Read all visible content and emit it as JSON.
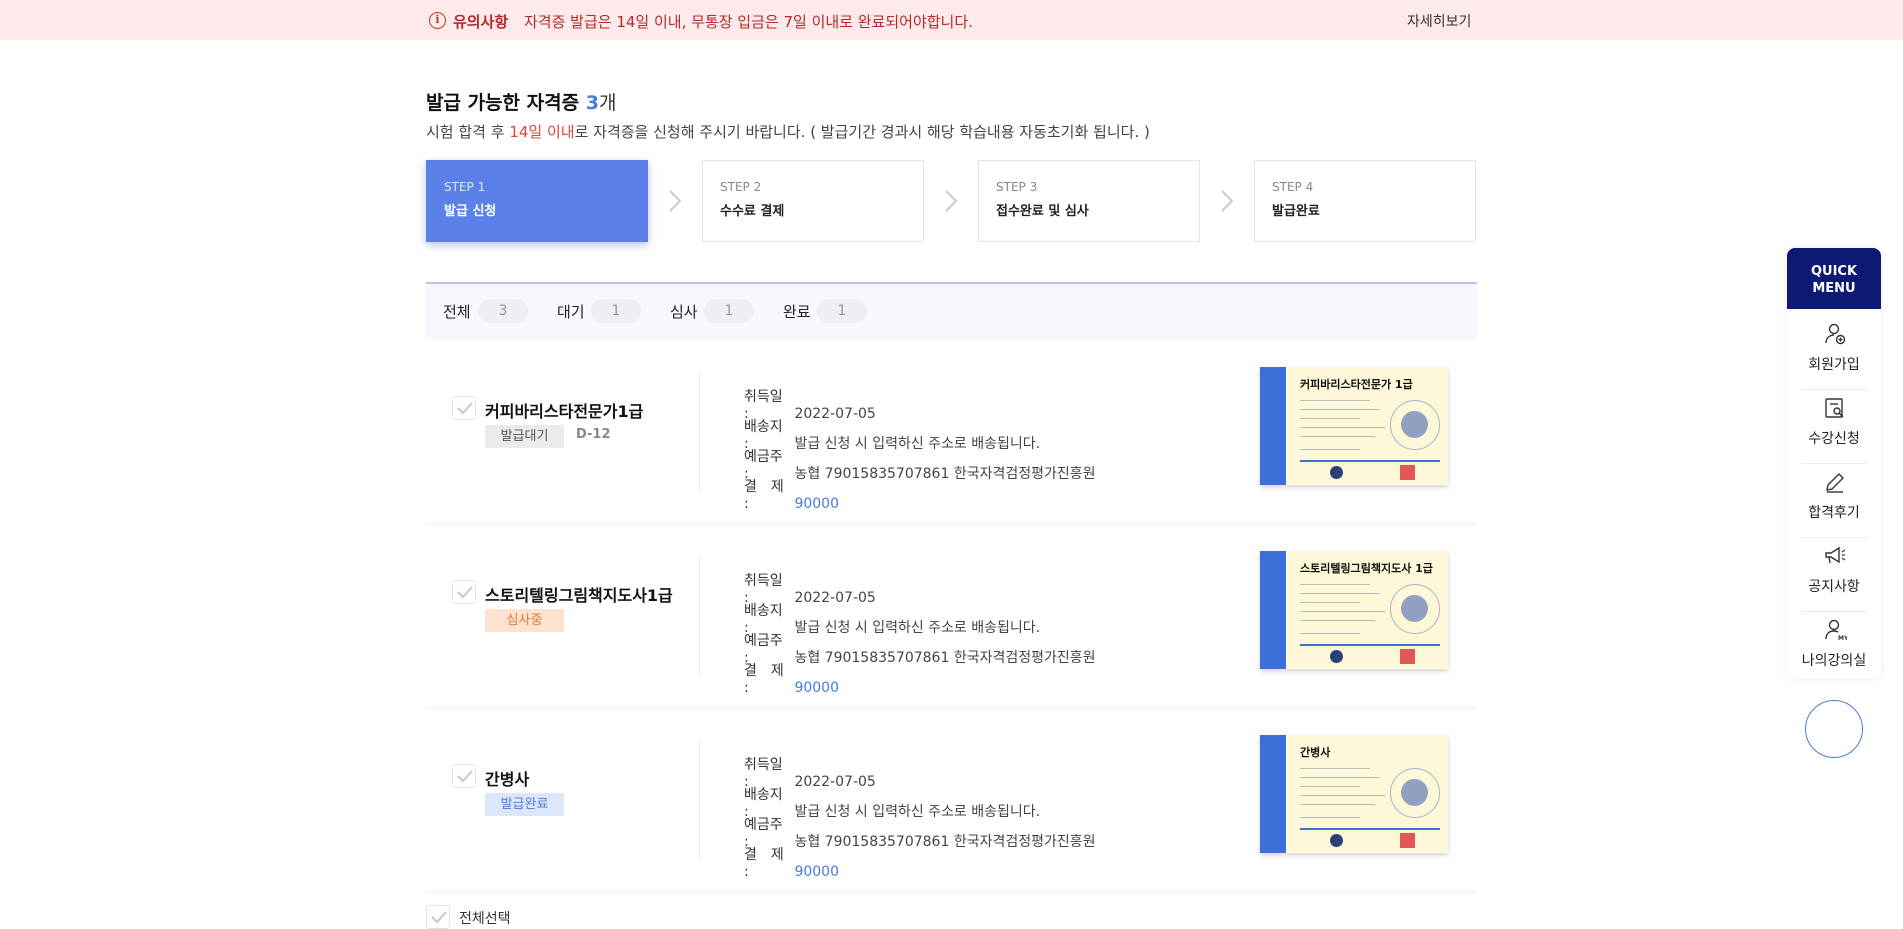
{
  "notice": {
    "label": "유의사항",
    "message": "자격증 발급은 14일 이내, 무통장 입금은 7일 이내로 완료되어야합니다.",
    "more_link": "자세히보기"
  },
  "heading": {
    "title": "발급 가능한 자격증",
    "count": "3",
    "unit": "개",
    "sub_before": "시험 합격 후 ",
    "sub_highlight": "14일 이내",
    "sub_after": "로 자격증을 신청해 주시기 바랍니다. ( 발급기간 경과시 해당 학습내용 자동초기화 됩니다. )"
  },
  "steps": [
    {
      "num": "STEP 1",
      "name": "발급 신청"
    },
    {
      "num": "STEP 2",
      "name": "수수료 결제"
    },
    {
      "num": "STEP 3",
      "name": "접수완료 및 심사"
    },
    {
      "num": "STEP 4",
      "name": "발급완료"
    }
  ],
  "filters": [
    {
      "label": "전체",
      "count": "3"
    },
    {
      "label": "대기",
      "count": "1"
    },
    {
      "label": "심사",
      "count": "1"
    },
    {
      "label": "완료",
      "count": "1"
    }
  ],
  "info_labels": {
    "date": "취득일 :",
    "ship": "배송지 :",
    "account": "예금주 :",
    "pay": "결　제 :"
  },
  "items": [
    {
      "title": "커피바리스타전문가1급",
      "status": "발급대기",
      "dday": "D-12",
      "date": "2022-07-05",
      "ship": "발급 신청 시 입력하신 주소로 배송됩니다.",
      "account": "농협 79015835707861 한국자격검정평가진흥원",
      "pay": "90000",
      "cert_title": "커피바리스타전문가 1급"
    },
    {
      "title": "스토리텔링그림책지도사1급",
      "status": "심사중",
      "dday": "",
      "date": "2022-07-05",
      "ship": "발급 신청 시 입력하신 주소로 배송됩니다.",
      "account": "농협 79015835707861 한국자격검정평가진흥원",
      "pay": "90000",
      "cert_title": "스토리텔링그림책지도사 1급"
    },
    {
      "title": "간병사",
      "status": "발급완료",
      "dday": "",
      "date": "2022-07-05",
      "ship": "발급 신청 시 입력하신 주소로 배송됩니다.",
      "account": "농협 79015835707861 한국자격검정평가진흥원",
      "pay": "90000",
      "cert_title": "간병사"
    }
  ],
  "select_all": "전체선택",
  "quick_menu": {
    "header_line1": "QUICK",
    "header_line2": "MENU",
    "items": [
      {
        "label": "회원가입",
        "icon": "user-add-icon"
      },
      {
        "label": "수강신청",
        "icon": "search-document-icon"
      },
      {
        "label": "합격후기",
        "icon": "pencil-icon"
      },
      {
        "label": "공지사항",
        "icon": "megaphone-icon"
      },
      {
        "label": "나의강의실",
        "icon": "user-my-icon"
      }
    ]
  },
  "colors": {
    "accent": "#5b80e8",
    "notice_bg": "#fdeaea",
    "notice_text": "#b8282a",
    "quick_header": "#0d1a73"
  }
}
